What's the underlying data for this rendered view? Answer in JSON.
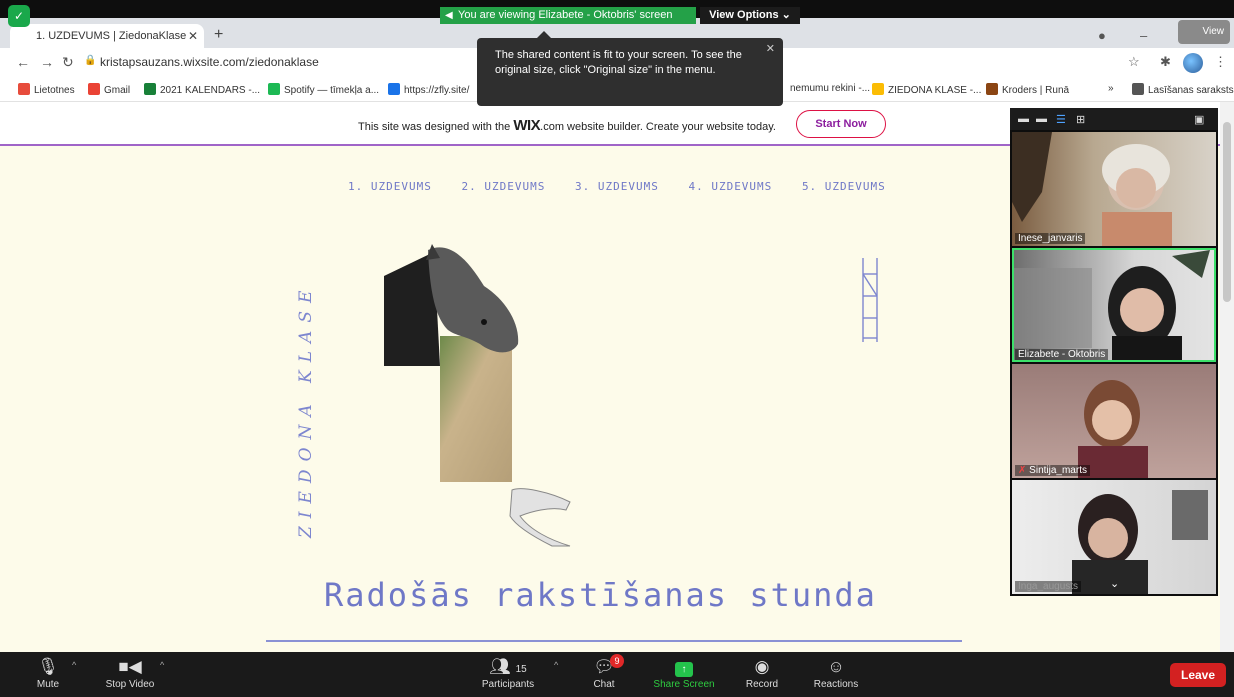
{
  "zoom": {
    "viewing_banner": "You are viewing Elizabete - Oktobris' screen",
    "view_options": "View Options",
    "view_chip": "View",
    "tooltip": "The shared content is fit to your screen. To see the original size, click \"Original size\" in the menu.",
    "toolbar": {
      "mute": "Mute",
      "stop_video": "Stop Video",
      "participants": "Participants",
      "participants_count": "15",
      "chat": "Chat",
      "chat_badge": "9",
      "share_screen": "Share Screen",
      "record": "Record",
      "reactions": "Reactions",
      "leave": "Leave"
    },
    "participants": [
      {
        "name": "Inese_janvaris"
      },
      {
        "name": "Elizabete - Oktobris"
      },
      {
        "name": "Sintija_marts"
      },
      {
        "name": "Inga_augusts"
      }
    ]
  },
  "browser": {
    "tab_title": "1. UZDEVUMS | ZiedonaKlase",
    "url": "kristapsauzans.wixsite.com/ziedonaklase",
    "bookmarks": [
      {
        "label": "Lietotnes",
        "color": "#e74c3c"
      },
      {
        "label": "Gmail",
        "color": "#ea4335"
      },
      {
        "label": "2021 KALENDARS -...",
        "color": "#188038"
      },
      {
        "label": "Spotify — tīmekļa a...",
        "color": "#1db954"
      },
      {
        "label": "https://zfly.site/",
        "color": "#1a73e8"
      },
      {
        "label": "nemumu rekini -...",
        "color": "#888888"
      },
      {
        "label": "ZIEDONA KLASE -...",
        "color": "#fbbc04"
      },
      {
        "label": "Kroders | Runā",
        "color": "#8b4513"
      },
      {
        "label": "Lasīšanas saraksts",
        "color": "#555555"
      }
    ]
  },
  "wix": {
    "banner_before": "This site was designed with the ",
    "brand": "WIX",
    "banner_after": ".com website builder. Create your website today.",
    "cta": "Start Now"
  },
  "site": {
    "nav": [
      "1. UZDEVUMS",
      "2. UZDEVUMS",
      "3. UZDEVUMS",
      "4. UZDEVUMS",
      "5. UZDEVUMS"
    ],
    "vertical_title": "ZIEDONA KLASE",
    "heading": "Radošās rakstīšanas stunda"
  },
  "colors": {
    "accent": "#6f78c7",
    "zoom_green": "#24a148",
    "leave_red": "#d32121",
    "wix_purple": "#a064c8"
  }
}
